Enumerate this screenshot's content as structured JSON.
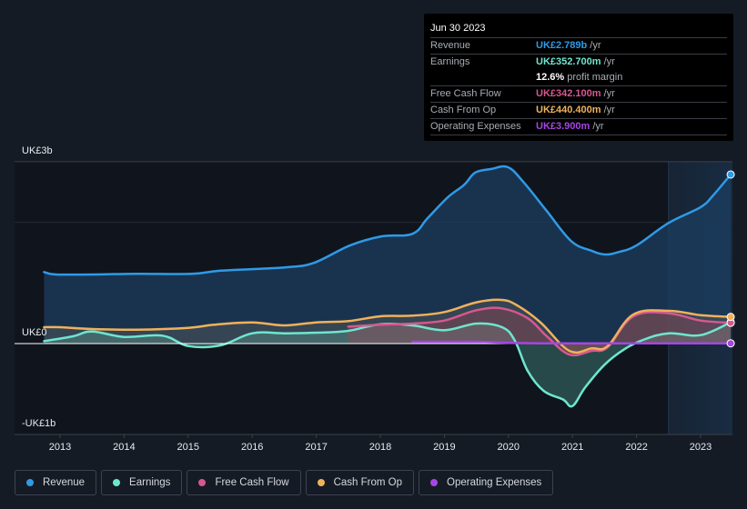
{
  "tooltip": {
    "date": "Jun 30 2023",
    "rows": [
      {
        "label": "Revenue",
        "value": "UK£2.789b",
        "unit": "/yr",
        "color": "#2f9ae6"
      },
      {
        "label": "Earnings",
        "value": "UK£352.700m",
        "unit": "/yr",
        "color": "#6ee6cf"
      },
      {
        "label": "",
        "value": "12.6%",
        "unit": "profit margin",
        "color": "#ffffff"
      },
      {
        "label": "Free Cash Flow",
        "value": "UK£342.100m",
        "unit": "/yr",
        "color": "#d6588f"
      },
      {
        "label": "Cash From Op",
        "value": "UK£440.400m",
        "unit": "/yr",
        "color": "#f0b15c"
      },
      {
        "label": "Operating Expenses",
        "value": "UK£3.900m",
        "unit": "/yr",
        "color": "#a546e3"
      }
    ]
  },
  "legend": [
    {
      "label": "Revenue",
      "color": "#2f9ae6"
    },
    {
      "label": "Earnings",
      "color": "#6ee6cf"
    },
    {
      "label": "Free Cash Flow",
      "color": "#d6588f"
    },
    {
      "label": "Cash From Op",
      "color": "#f0b15c"
    },
    {
      "label": "Operating Expenses",
      "color": "#a546e3"
    }
  ],
  "chart_data": {
    "type": "area",
    "title": "",
    "xlabel": "",
    "ylabel": "",
    "currency": "UK£",
    "units": "billions",
    "ylim": [
      -1,
      3
    ],
    "xlim": [
      2012.75,
      2023.5
    ],
    "y_tick_labels": [
      {
        "value": 3,
        "label": "UK£3b"
      },
      {
        "value": 0,
        "label": "UK£0"
      },
      {
        "value": -1,
        "label": "-UK£1b"
      }
    ],
    "x_tick_labels": [
      "2013",
      "2014",
      "2015",
      "2016",
      "2017",
      "2018",
      "2019",
      "2020",
      "2021",
      "2022",
      "2023"
    ],
    "grid": true,
    "highlight_range": [
      2022.5,
      2023.5
    ],
    "legend_position": "bottom-left",
    "series": [
      {
        "name": "Revenue",
        "color": "#2f9ae6",
        "points": [
          [
            2012.75,
            1.18
          ],
          [
            2012.94,
            1.14
          ],
          [
            2013.48,
            1.14
          ],
          [
            2014.2,
            1.15
          ],
          [
            2015.05,
            1.15
          ],
          [
            2015.47,
            1.2
          ],
          [
            2016.04,
            1.23
          ],
          [
            2016.54,
            1.26
          ],
          [
            2016.96,
            1.33
          ],
          [
            2017.53,
            1.62
          ],
          [
            2018.03,
            1.77
          ],
          [
            2018.5,
            1.81
          ],
          [
            2018.74,
            2.07
          ],
          [
            2019.05,
            2.41
          ],
          [
            2019.31,
            2.62
          ],
          [
            2019.48,
            2.82
          ],
          [
            2019.73,
            2.88
          ],
          [
            2019.99,
            2.91
          ],
          [
            2020.23,
            2.67
          ],
          [
            2020.59,
            2.2
          ],
          [
            2020.98,
            1.69
          ],
          [
            2021.3,
            1.53
          ],
          [
            2021.51,
            1.47
          ],
          [
            2021.72,
            1.51
          ],
          [
            2022.0,
            1.62
          ],
          [
            2022.5,
            1.99
          ],
          [
            2023.0,
            2.25
          ],
          [
            2023.2,
            2.45
          ],
          [
            2023.47,
            2.789
          ]
        ]
      },
      {
        "name": "Earnings",
        "color": "#6ee6cf",
        "points": [
          [
            2012.75,
            0.04
          ],
          [
            2013.2,
            0.12
          ],
          [
            2013.5,
            0.2
          ],
          [
            2014.0,
            0.11
          ],
          [
            2014.6,
            0.13
          ],
          [
            2015.0,
            -0.04
          ],
          [
            2015.5,
            -0.03
          ],
          [
            2016.0,
            0.17
          ],
          [
            2016.5,
            0.17
          ],
          [
            2017.0,
            0.18
          ],
          [
            2017.5,
            0.21
          ],
          [
            2018.0,
            0.32
          ],
          [
            2018.5,
            0.3
          ],
          [
            2019.0,
            0.22
          ],
          [
            2019.5,
            0.33
          ],
          [
            2019.9,
            0.27
          ],
          [
            2020.1,
            0.05
          ],
          [
            2020.3,
            -0.45
          ],
          [
            2020.55,
            -0.78
          ],
          [
            2020.85,
            -0.92
          ],
          [
            2021.0,
            -1.03
          ],
          [
            2021.2,
            -0.72
          ],
          [
            2021.5,
            -0.35
          ],
          [
            2021.8,
            -0.1
          ],
          [
            2022.1,
            0.06
          ],
          [
            2022.5,
            0.17
          ],
          [
            2023.0,
            0.14
          ],
          [
            2023.47,
            0.3527
          ]
        ]
      },
      {
        "name": "Free Cash Flow",
        "color": "#d6588f",
        "points": [
          [
            2017.5,
            0.28
          ],
          [
            2018.0,
            0.31
          ],
          [
            2018.5,
            0.33
          ],
          [
            2019.0,
            0.38
          ],
          [
            2019.5,
            0.55
          ],
          [
            2019.9,
            0.58
          ],
          [
            2020.3,
            0.42
          ],
          [
            2020.6,
            0.12
          ],
          [
            2020.95,
            -0.18
          ],
          [
            2021.3,
            -0.12
          ],
          [
            2021.55,
            -0.06
          ],
          [
            2021.95,
            0.45
          ],
          [
            2022.5,
            0.5
          ],
          [
            2023.0,
            0.38
          ],
          [
            2023.47,
            0.3421
          ]
        ]
      },
      {
        "name": "Cash From Op",
        "color": "#f0b15c",
        "points": [
          [
            2012.75,
            0.27
          ],
          [
            2013.0,
            0.27
          ],
          [
            2013.5,
            0.24
          ],
          [
            2014.2,
            0.23
          ],
          [
            2015.0,
            0.26
          ],
          [
            2015.4,
            0.31
          ],
          [
            2016.0,
            0.35
          ],
          [
            2016.5,
            0.3
          ],
          [
            2017.0,
            0.35
          ],
          [
            2017.5,
            0.37
          ],
          [
            2018.0,
            0.45
          ],
          [
            2018.5,
            0.46
          ],
          [
            2019.0,
            0.52
          ],
          [
            2019.5,
            0.68
          ],
          [
            2019.9,
            0.72
          ],
          [
            2020.15,
            0.62
          ],
          [
            2020.5,
            0.35
          ],
          [
            2020.95,
            -0.12
          ],
          [
            2021.3,
            -0.08
          ],
          [
            2021.55,
            -0.04
          ],
          [
            2021.95,
            0.48
          ],
          [
            2022.5,
            0.54
          ],
          [
            2023.0,
            0.47
          ],
          [
            2023.47,
            0.4404
          ]
        ]
      },
      {
        "name": "Operating Expenses",
        "color": "#a546e3",
        "points": [
          [
            2018.5,
            0.03
          ],
          [
            2019.0,
            0.03
          ],
          [
            2019.5,
            0.03
          ],
          [
            2020.0,
            0.01
          ],
          [
            2020.5,
            0.004
          ],
          [
            2021.0,
            0.004
          ],
          [
            2022.0,
            0.004
          ],
          [
            2023.0,
            0.004
          ],
          [
            2023.47,
            0.0039
          ]
        ]
      }
    ]
  }
}
